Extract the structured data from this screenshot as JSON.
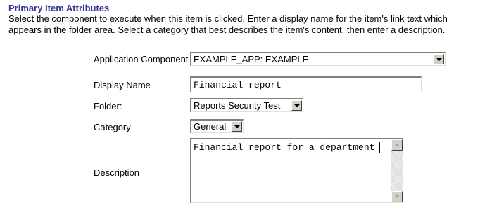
{
  "section": {
    "title": "Primary Item Attributes",
    "description_line1": "Select the component to execute when this item is clicked. Enter a display name for the item's link text which",
    "description_line2": "appears in the folder area. Select a category that best describes the item's content, then enter a description."
  },
  "form": {
    "application_component": {
      "label": "Application Component",
      "value": "EXAMPLE_APP: EXAMPLE"
    },
    "display_name": {
      "label": "Display Name",
      "value": "Financial report"
    },
    "folder": {
      "label": "Folder:",
      "value": "Reports Security Test"
    },
    "category": {
      "label": "Category",
      "value": "General"
    },
    "description": {
      "label": "Description",
      "value": "Financial report for a department"
    }
  },
  "icons": {
    "dropdown": "chevron-down-icon",
    "scroll_up": "scroll-up-icon",
    "scroll_down": "scroll-down-icon"
  },
  "colors": {
    "title": "#333399",
    "control_face": "#d4d0c8"
  }
}
